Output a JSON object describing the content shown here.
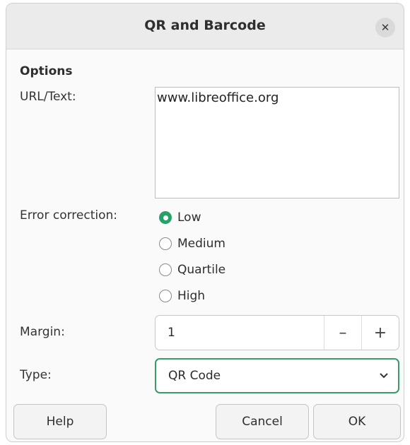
{
  "dialog": {
    "title": "QR and Barcode",
    "close_icon": "close-icon"
  },
  "options": {
    "section_title": "Options",
    "url_label": "URL/Text:",
    "url_value": "www.libreoffice.org",
    "error_correction_label": "Error correction:",
    "error_correction_options": [
      {
        "label": "Low",
        "checked": true
      },
      {
        "label": "Medium",
        "checked": false
      },
      {
        "label": "Quartile",
        "checked": false
      },
      {
        "label": "High",
        "checked": false
      }
    ],
    "margin_label": "Margin:",
    "margin_value": "1",
    "margin_decrement": "–",
    "margin_increment": "+",
    "type_label": "Type:",
    "type_value": "QR Code"
  },
  "buttons": {
    "help": "Help",
    "cancel": "Cancel",
    "ok": "OK"
  },
  "colors": {
    "accent": "#26a269",
    "focus_border": "#3a9a6a"
  }
}
